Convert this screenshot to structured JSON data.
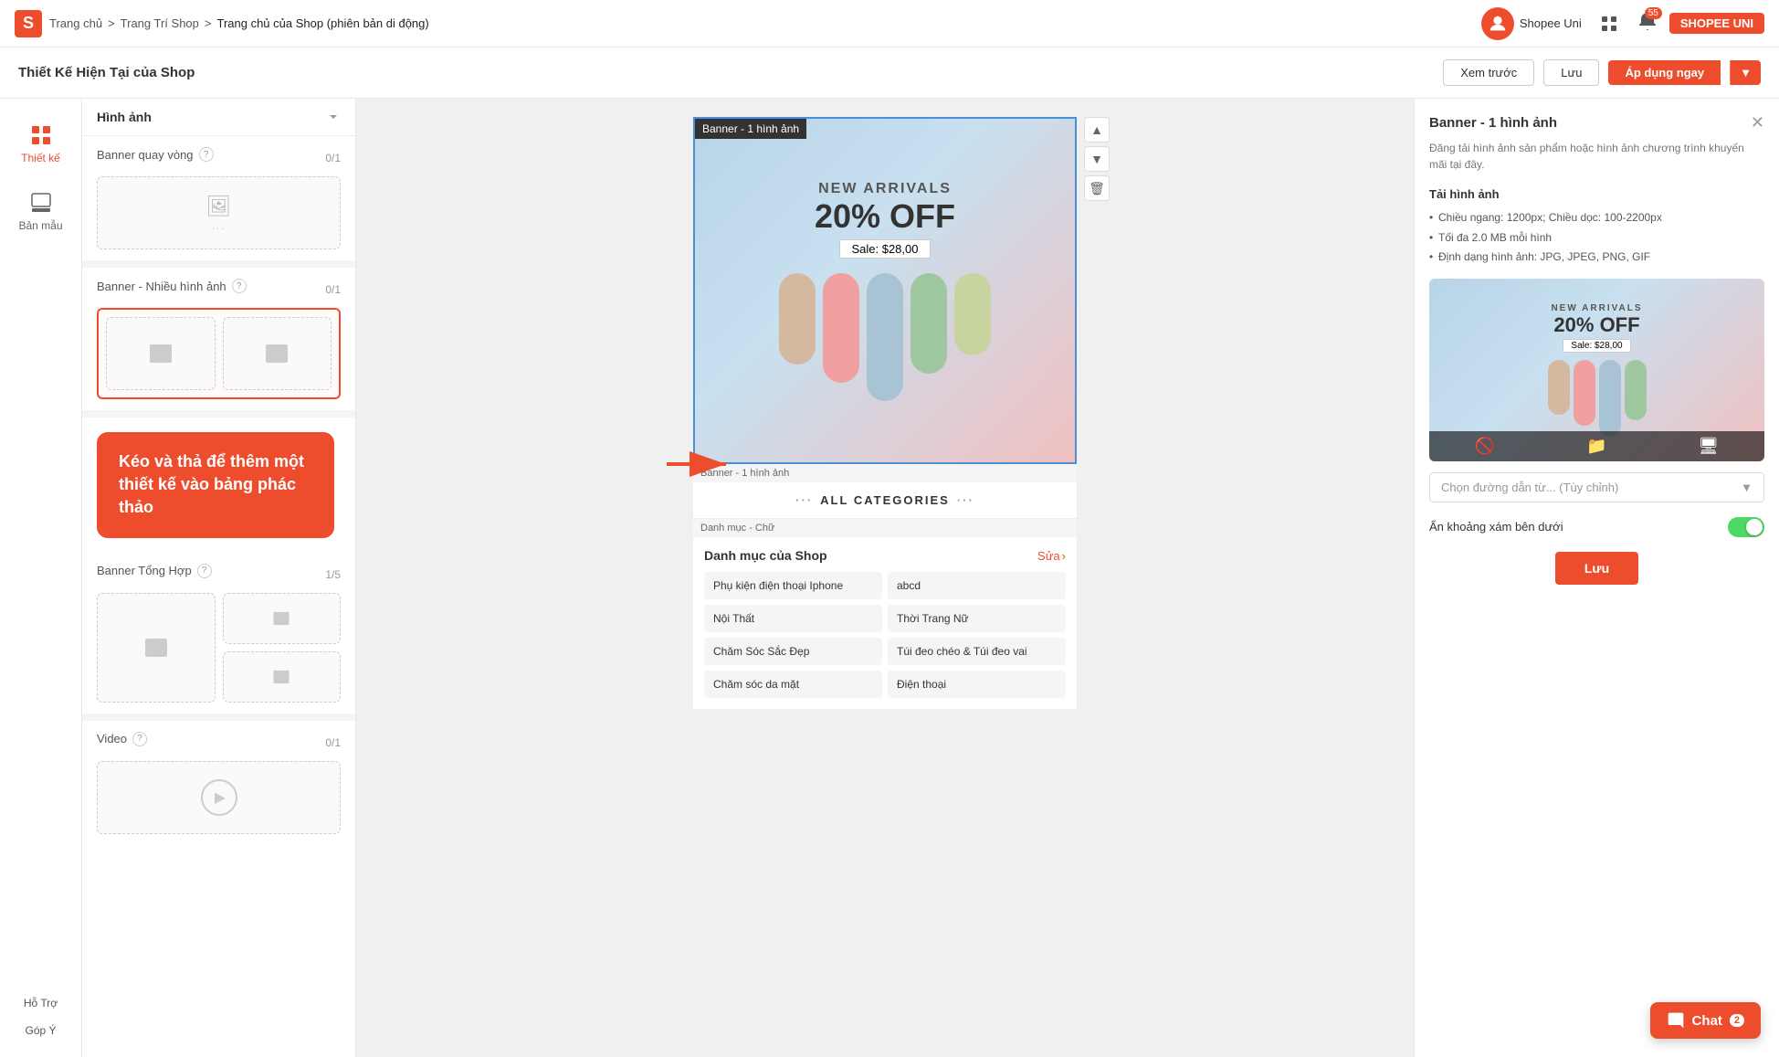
{
  "topnav": {
    "logo_text": "S",
    "breadcrumb": {
      "home": "Trang chủ",
      "sep1": ">",
      "shop_design": "Trang Trí Shop",
      "sep2": ">",
      "current": "Trang chủ của Shop (phiên bản di động)"
    },
    "shopee_uni_label": "Shopee Uni",
    "bell_badge": "55",
    "user_label": "SHOPEE UNI"
  },
  "toolbar": {
    "title": "Thiết Kế Hiện Tại của Shop",
    "preview_label": "Xem trước",
    "save_label": "Lưu",
    "apply_label": "Áp dụng ngay"
  },
  "left_sidebar": {
    "items": [
      {
        "id": "thiet-ke",
        "label": "Thiết kế",
        "active": true
      },
      {
        "id": "ban-mau",
        "label": "Bản mẫu",
        "active": false
      }
    ],
    "bottom": [
      {
        "id": "ho-tro",
        "label": "Hỗ Trợ"
      },
      {
        "id": "gop-y",
        "label": "Góp Ý"
      }
    ]
  },
  "components_panel": {
    "title": "Hình ảnh",
    "sections": [
      {
        "id": "banner-quay-vong",
        "label": "Banner quay vòng",
        "count": "0/1",
        "has_help": true,
        "type": "single"
      },
      {
        "id": "banner-nhieu-hinh-anh",
        "label": "Banner - Nhiều hình ảnh",
        "count": "0/1",
        "has_help": true,
        "selected": true,
        "type": "double"
      },
      {
        "id": "banner-tong-hop",
        "label": "Banner Tổng Hợp",
        "count": "1/5",
        "has_help": true,
        "type": "mixed"
      },
      {
        "id": "video",
        "label": "Video",
        "count": "0/1",
        "has_help": true,
        "type": "video"
      }
    ],
    "tooltip": "Kéo và thả để thêm một thiết kế vào bảng phác thảo"
  },
  "canvas": {
    "banner_label": "Banner - 1 hình ảnh",
    "banner_new_arrivals": "NEW ARRIVALS",
    "banner_off": "20% OFF",
    "banner_sale": "Sale: $28,00",
    "capsule_colors": [
      "#d4b8a0",
      "#f0a0a0",
      "#a8c4d4",
      "#a0c8a0",
      "#c8d4a0"
    ],
    "all_categories": "ALL CATEGORIES",
    "canvas_label_banner1": "Banner - 1 hình ảnh",
    "canvas_label_danh_muc": "Danh mục - Chữ",
    "shop_categories_title": "Danh mục của Shop",
    "shop_categories_edit": "Sửa",
    "categories": [
      {
        "left": "Phụ kiện điện thoại Iphone",
        "right": "abcd"
      },
      {
        "left": "Nội Thất",
        "right": "Thời Trang Nữ"
      },
      {
        "left": "Chăm Sóc Sắc Đẹp",
        "right": "Túi đeo chéo & Túi đeo vai"
      },
      {
        "left": "Chăm sóc da mặt",
        "right": "Điện thoại"
      }
    ]
  },
  "right_panel": {
    "title": "Banner - 1 hình ảnh",
    "description": "Đăng tải hình ảnh sản phẩm hoặc hình ảnh chương trình khuyến mãi tại đây.",
    "upload_section_label": "Tải hình ảnh",
    "upload_info": [
      "Chiều ngang: 1200px; Chiều dọc: 100-2200px",
      "Tối đa 2.0 MB mỗi hình",
      "Định dạng hình ảnh: JPG, JPEG, PNG, GIF"
    ],
    "select_link_placeholder": "Chọn đường dẫn từ... (Tùy chỉnh)",
    "toggle_label": "Ẩn khoảng xám bên dưới",
    "save_label": "Lưu",
    "preview": {
      "new_arrivals": "NEW ARRIVALS",
      "off": "20% OFF",
      "sale": "Sale: $28,00"
    }
  },
  "chat": {
    "label": "Chat",
    "badge": "2"
  }
}
